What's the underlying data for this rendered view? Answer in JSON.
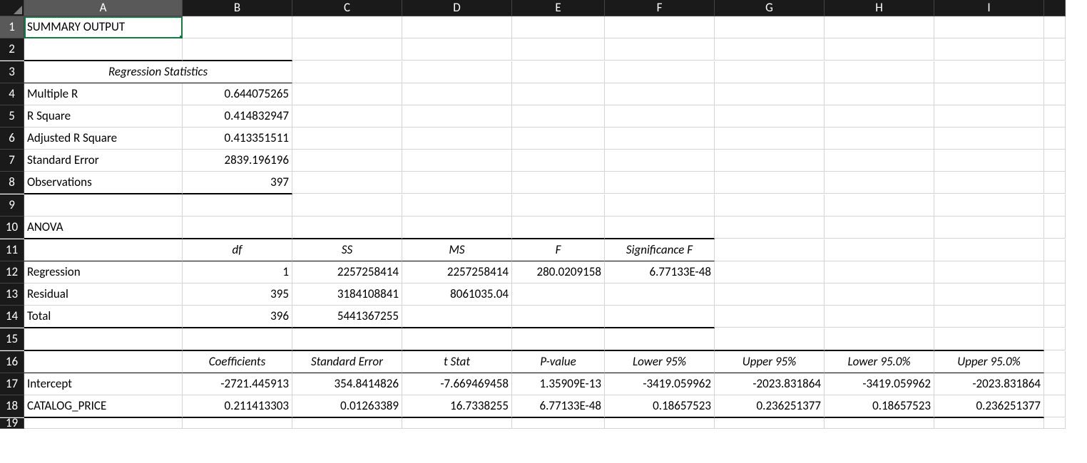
{
  "columns": [
    "A",
    "B",
    "C",
    "D",
    "E",
    "F",
    "G",
    "H",
    "I"
  ],
  "rows": [
    "1",
    "2",
    "3",
    "4",
    "5",
    "6",
    "7",
    "8",
    "9",
    "10",
    "11",
    "12",
    "13",
    "14",
    "15",
    "16",
    "17",
    "18",
    "19"
  ],
  "a1": "SUMMARY OUTPUT",
  "regStatsTitle": "Regression Statistics",
  "regStats": {
    "0": {
      "label": "Multiple R",
      "val": "0.644075265"
    },
    "1": {
      "label": "R Square",
      "val": "0.414832947"
    },
    "2": {
      "label": "Adjusted R Square",
      "val": "0.413351511"
    },
    "3": {
      "label": "Standard Error",
      "val": "2839.196196"
    },
    "4": {
      "label": "Observations",
      "val": "397"
    }
  },
  "anovaTitle": "ANOVA",
  "anovaHdr": {
    "b": "df",
    "c": "SS",
    "d": "MS",
    "e": "F",
    "f": "Significance F"
  },
  "anova": {
    "0": {
      "label": "Regression",
      "b": "1",
      "c": "2257258414",
      "d": "2257258414",
      "e": "280.0209158",
      "f": "6.77133E-48"
    },
    "1": {
      "label": "Residual",
      "b": "395",
      "c": "3184108841",
      "d": "8061035.04",
      "e": "",
      "f": ""
    },
    "2": {
      "label": "Total",
      "b": "396",
      "c": "5441367255",
      "d": "",
      "e": "",
      "f": ""
    }
  },
  "coefHdr": {
    "b": "Coefficients",
    "c": "Standard Error",
    "d": "t Stat",
    "e": "P-value",
    "f": "Lower 95%",
    "g": "Upper 95%",
    "h": "Lower 95.0%",
    "i": "Upper 95.0%"
  },
  "coef": {
    "0": {
      "label": "Intercept",
      "b": "-2721.445913",
      "c": "354.8414826",
      "d": "-7.669469458",
      "e": "1.35909E-13",
      "f": "-3419.059962",
      "g": "-2023.831864",
      "h": "-3419.059962",
      "i": "-2023.831864"
    },
    "1": {
      "label": "CATALOG_PRICE",
      "b": "0.211413303",
      "c": "0.01263389",
      "d": "16.7338255",
      "e": "6.77133E-48",
      "f": "0.18657523",
      "g": "0.236251377",
      "h": "0.18657523",
      "i": "0.236251377"
    }
  }
}
